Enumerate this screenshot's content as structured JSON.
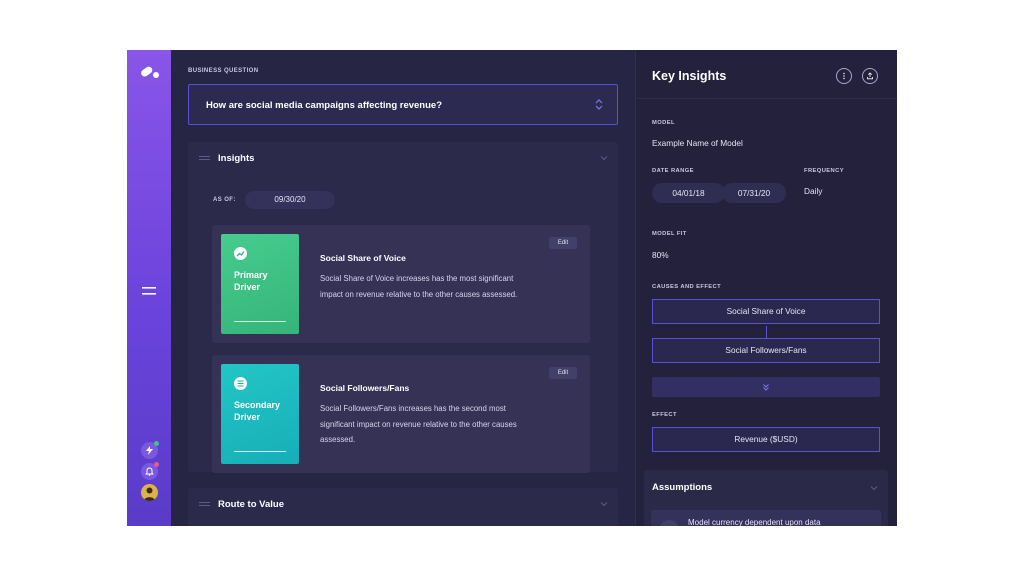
{
  "business_question": {
    "label": "BUSINESS QUESTION",
    "question": "How are social media campaigns affecting revenue?"
  },
  "insights": {
    "title": "Insights",
    "as_of_label": "AS OF:",
    "as_of_date": "09/30/20",
    "cards": [
      {
        "driver_label": "Primary Driver",
        "driver_color": "#3fc38a",
        "driver_icon": "trend-up-icon",
        "title": "Social Share of Voice",
        "description": "Social Share of Voice increases has the most significant impact on revenue relative to the other causes assessed.",
        "edit_label": "Edit"
      },
      {
        "driver_label": "Secondary Driver",
        "driver_color": "#1fbdbf",
        "driver_icon": "list-icon",
        "title": "Social Followers/Fans",
        "description": "Social Followers/Fans increases has the second most significant impact on revenue relative to the other causes assessed.",
        "edit_label": "Edit"
      }
    ]
  },
  "route_to_value": {
    "title": "Route to Value"
  },
  "key_insights": {
    "title": "Key Insights",
    "model_label": "MODEL",
    "model_value": "Example Name of Model",
    "date_range_label": "DATE RANGE",
    "date_start": "04/01/18",
    "date_end": "07/31/20",
    "frequency_label": "FREQUENCY",
    "frequency_value": "Daily",
    "model_fit_label": "MODEL FIT",
    "model_fit_value": "80%",
    "causes_label": "CAUSES AND EFFECT",
    "causes": [
      "Social Share of Voice",
      "Social Followers/Fans"
    ],
    "effect_label": "EFFECT",
    "effect_value": "Revenue ($USD)"
  },
  "assumptions": {
    "title": "Assumptions",
    "first_item": "Model currency dependent upon data"
  },
  "colors": {
    "accent": "#5b4fd6",
    "rail_top": "#8a55e8",
    "notification_green": "#3fc38a",
    "notification_pink": "#e85a8a"
  }
}
